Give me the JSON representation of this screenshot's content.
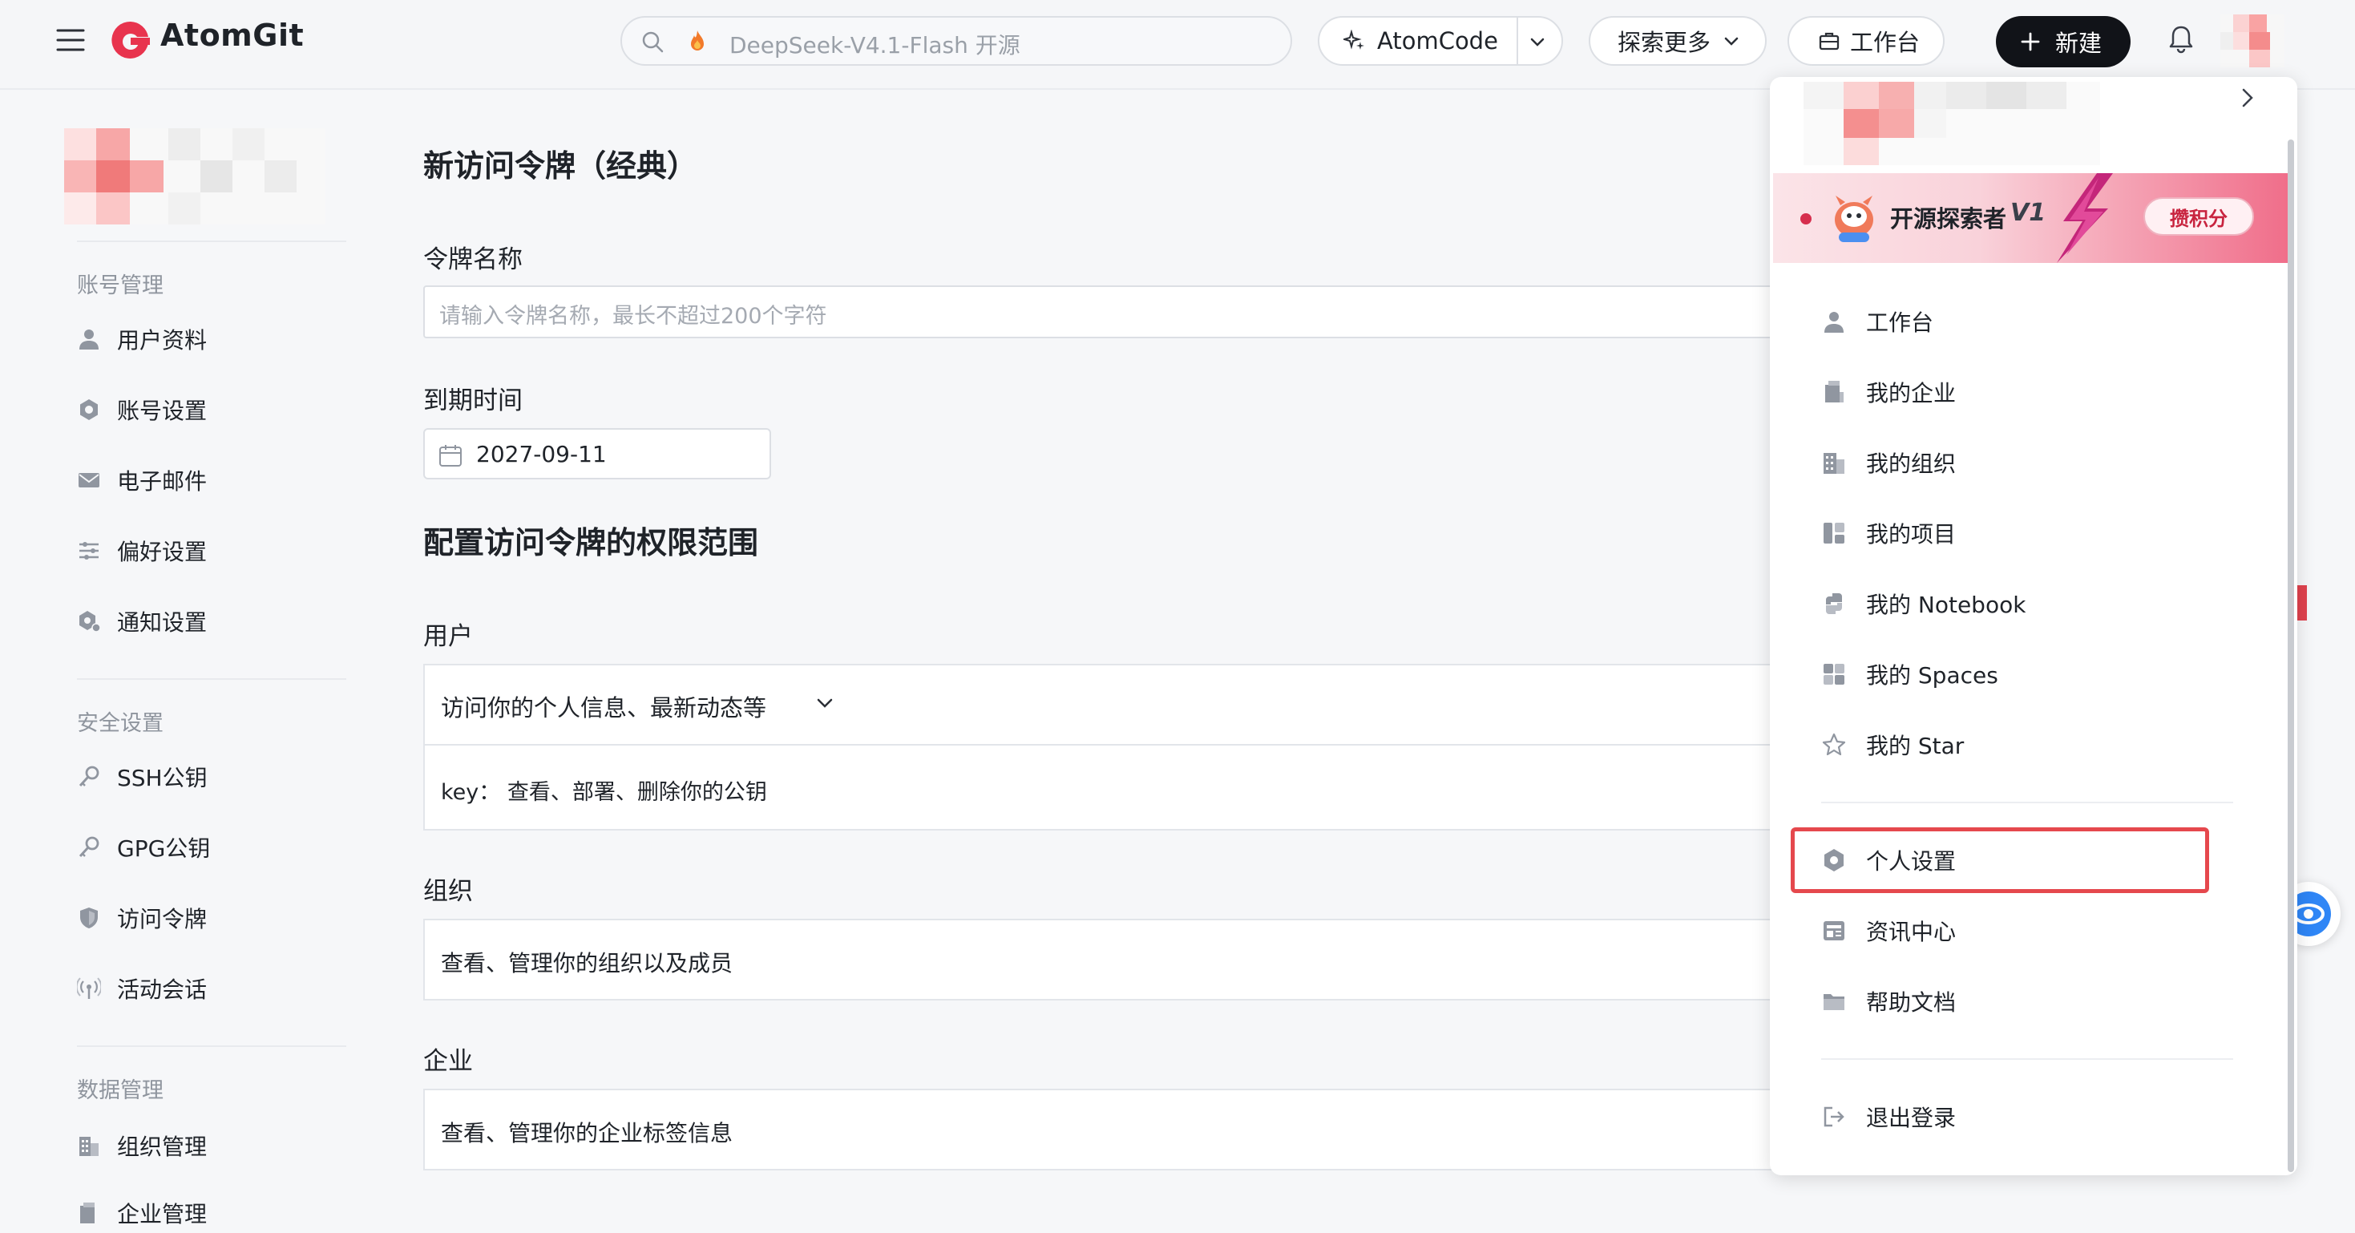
{
  "header": {
    "logo_text": "AtomGit",
    "search_placeholder": "DeepSeek-V4.1-Flash 开源",
    "atomcode_label": "AtomCode",
    "explore_label": "探索更多",
    "workbench_label": "工作台",
    "new_label": "新建"
  },
  "sidebar": {
    "sections": [
      {
        "title": "账号管理",
        "items": [
          {
            "label": "用户资料",
            "icon": "user-icon"
          },
          {
            "label": "账号设置",
            "icon": "gear-icon"
          },
          {
            "label": "电子邮件",
            "icon": "mail-icon"
          },
          {
            "label": "偏好设置",
            "icon": "sliders-icon"
          },
          {
            "label": "通知设置",
            "icon": "notification-gear-icon"
          }
        ]
      },
      {
        "title": "安全设置",
        "items": [
          {
            "label": "SSH公钥",
            "icon": "key-icon"
          },
          {
            "label": "GPG公钥",
            "icon": "key-icon"
          },
          {
            "label": "访问令牌",
            "icon": "shield-icon"
          },
          {
            "label": "活动会话",
            "icon": "broadcast-icon"
          }
        ]
      },
      {
        "title": "数据管理",
        "items": [
          {
            "label": "组织管理",
            "icon": "building-icon"
          },
          {
            "label": "企业管理",
            "icon": "enterprise-icon"
          }
        ]
      }
    ]
  },
  "main": {
    "title": "新访问令牌（经典）",
    "name_label": "令牌名称",
    "name_placeholder": "请输入令牌名称，最长不超过200个字符",
    "expiry_label": "到期时间",
    "expiry_value": "2027-09-11",
    "scope_heading": "配置访问令牌的权限范围",
    "scopes": [
      {
        "label": "用户",
        "summary": "访问你的个人信息、最新动态等",
        "detail": "key：  查看、部署、删除你的公钥"
      },
      {
        "label": "组织",
        "summary": "查看、管理你的组织以及成员"
      },
      {
        "label": "企业",
        "summary": "查看、管理你的企业标签信息"
      }
    ]
  },
  "dropdown": {
    "banner_text": "开源探索者",
    "banner_level": "V1",
    "banner_button": "攒积分",
    "items": [
      {
        "label": "工作台",
        "icon": "user-icon"
      },
      {
        "label": "我的企业",
        "icon": "enterprise-icon"
      },
      {
        "label": "我的组织",
        "icon": "building-icon"
      },
      {
        "label": "我的项目",
        "icon": "project-icon"
      },
      {
        "label": "我的 Notebook",
        "icon": "notebook-icon"
      },
      {
        "label": "我的 Spaces",
        "icon": "spaces-icon"
      },
      {
        "label": "我的 Star",
        "icon": "star-icon"
      },
      {
        "label": "个人设置",
        "icon": "gear-icon"
      },
      {
        "label": "资讯中心",
        "icon": "news-icon"
      },
      {
        "label": "帮助文档",
        "icon": "folder-icon"
      },
      {
        "label": "退出登录",
        "icon": "logout-icon"
      }
    ]
  },
  "colors": {
    "brand": "#e8344e",
    "highlight": "#e5484d",
    "primary_button": "#111318"
  }
}
